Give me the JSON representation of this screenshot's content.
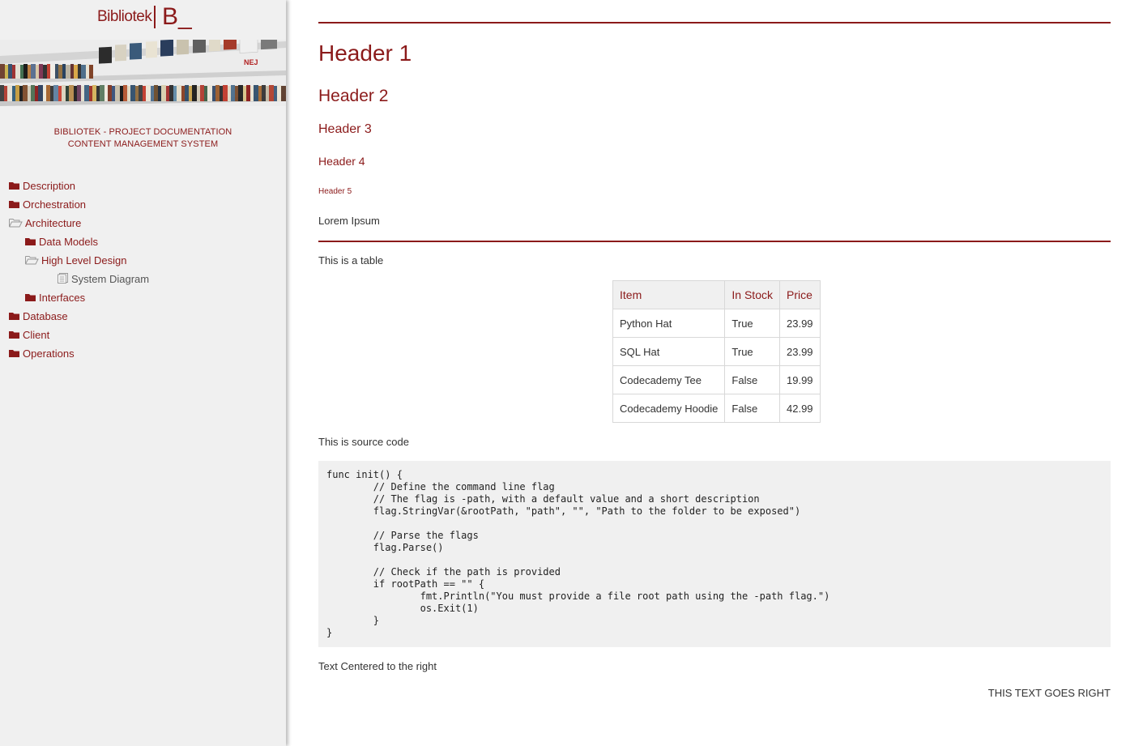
{
  "logo": {
    "wordmark": "Bibliotek",
    "mark": "B_"
  },
  "tagline": {
    "line1": "BIBLIOTEK - PROJECT DOCUMENTATION",
    "line2": "CONTENT MANAGEMENT SYSTEM"
  },
  "nav": {
    "items": [
      {
        "label": "Description",
        "icon": "folder-icon"
      },
      {
        "label": "Orchestration",
        "icon": "folder-icon"
      },
      {
        "label": "Architecture",
        "icon": "folder-open-icon"
      },
      {
        "label": "Data Models",
        "icon": "folder-icon"
      },
      {
        "label": "High Level Design",
        "icon": "folder-open-icon"
      },
      {
        "label": "System Diagram",
        "icon": "document-icon"
      },
      {
        "label": "Interfaces",
        "icon": "folder-icon"
      },
      {
        "label": "Database",
        "icon": "folder-icon"
      },
      {
        "label": "Client",
        "icon": "folder-icon"
      },
      {
        "label": "Operations",
        "icon": "folder-icon"
      }
    ]
  },
  "content": {
    "h1": "Header 1",
    "h2": "Header 2",
    "h3": "Header 3",
    "h4": "Header 4",
    "h5": "Header 5",
    "lorem": "Lorem Ipsum",
    "table_intro": "This is a table",
    "code_intro": "This is source code",
    "center_text": "Text Centered to the right",
    "right_text": "THIS TEXT GOES RIGHT"
  },
  "table": {
    "headers": [
      "Item",
      "In Stock",
      "Price"
    ],
    "rows": [
      [
        "Python Hat",
        "True",
        "23.99"
      ],
      [
        "SQL Hat",
        "True",
        "23.99"
      ],
      [
        "Codecademy Tee",
        "False",
        "19.99"
      ],
      [
        "Codecademy Hoodie",
        "False",
        "42.99"
      ]
    ]
  },
  "code": "func init() {\n        // Define the command line flag\n        // The flag is -path, with a default value and a short description\n        flag.StringVar(&rootPath, \"path\", \"\", \"Path to the folder to be exposed\")\n\n        // Parse the flags\n        flag.Parse()\n\n        // Check if the path is provided\n        if rootPath == \"\" {\n                fmt.Println(\"You must provide a file root path using the -path flag.\")\n                os.Exit(1)\n        }\n}",
  "colors": {
    "accent": "#8b1a1a",
    "sidebar_bg": "#f0f0f0",
    "code_bg": "#f0f0f0"
  }
}
